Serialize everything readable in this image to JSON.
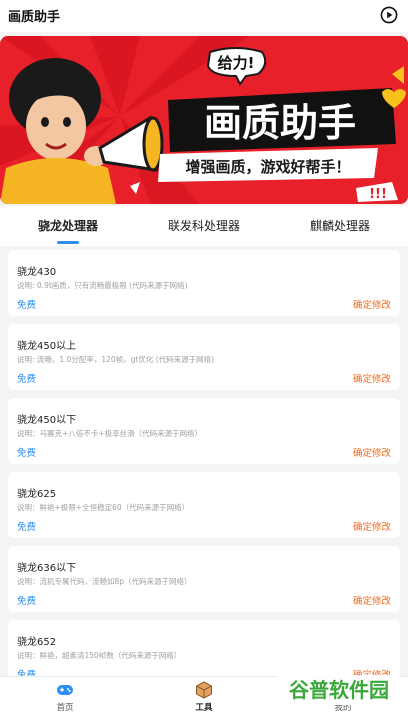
{
  "header": {
    "title": "画质助手",
    "play_icon": "play-circle-icon"
  },
  "banner": {
    "bubble": "给力!",
    "title": "画质助手",
    "slogan": "增强画质，游戏好帮手！",
    "exclaim": "!!!",
    "colors": {
      "background": "#e8202a",
      "title_bg": "#111111",
      "slogan_bg": "#ffffff"
    }
  },
  "tabs": [
    {
      "label": "骁龙处理器",
      "active": true
    },
    {
      "label": "联发科处理器",
      "active": false
    },
    {
      "label": "麒麟处理器",
      "active": false
    }
  ],
  "cards": [
    {
      "title": "骁龙430",
      "desc": "说明: 0.9t画质，只有流畅最极限 (代码来源于网络)",
      "free": "免费",
      "action": "确定修改"
    },
    {
      "title": "骁龙450以上",
      "desc": "说明: 流畅，1.0分配率，120帧，gt优化 (代码来源于网络)",
      "free": "免费",
      "action": "确定修改"
    },
    {
      "title": "骁龙450以下",
      "desc": "说明：马赛克+八倍不卡+极享丝滑（代码来源于网络）",
      "free": "免费",
      "action": "确定修改"
    },
    {
      "title": "骁龙625",
      "desc": "说明：鲜艳+极限+全恒稳定60（代码来源于网络）",
      "free": "免费",
      "action": "确定修改"
    },
    {
      "title": "骁龙636以下",
      "desc": "说明：流机专属代码，流畅如8p（代码来源于网络）",
      "free": "免费",
      "action": "确定修改"
    },
    {
      "title": "骁龙652",
      "desc": "说明：鲜艳，超素清150帧数（代码来源于网络）",
      "free": "免费",
      "action": "确定修改"
    }
  ],
  "bottom_nav": [
    {
      "label": "首页",
      "icon": "gamepad-icon"
    },
    {
      "label": "工具",
      "icon": "box-icon"
    },
    {
      "label": "我的",
      "icon": "user-icon"
    }
  ],
  "watermark": {
    "text": "谷普软件园"
  },
  "colors": {
    "accent": "#2f8ff0",
    "action": "#ef6a22",
    "page_bg": "#f4f4f4"
  }
}
